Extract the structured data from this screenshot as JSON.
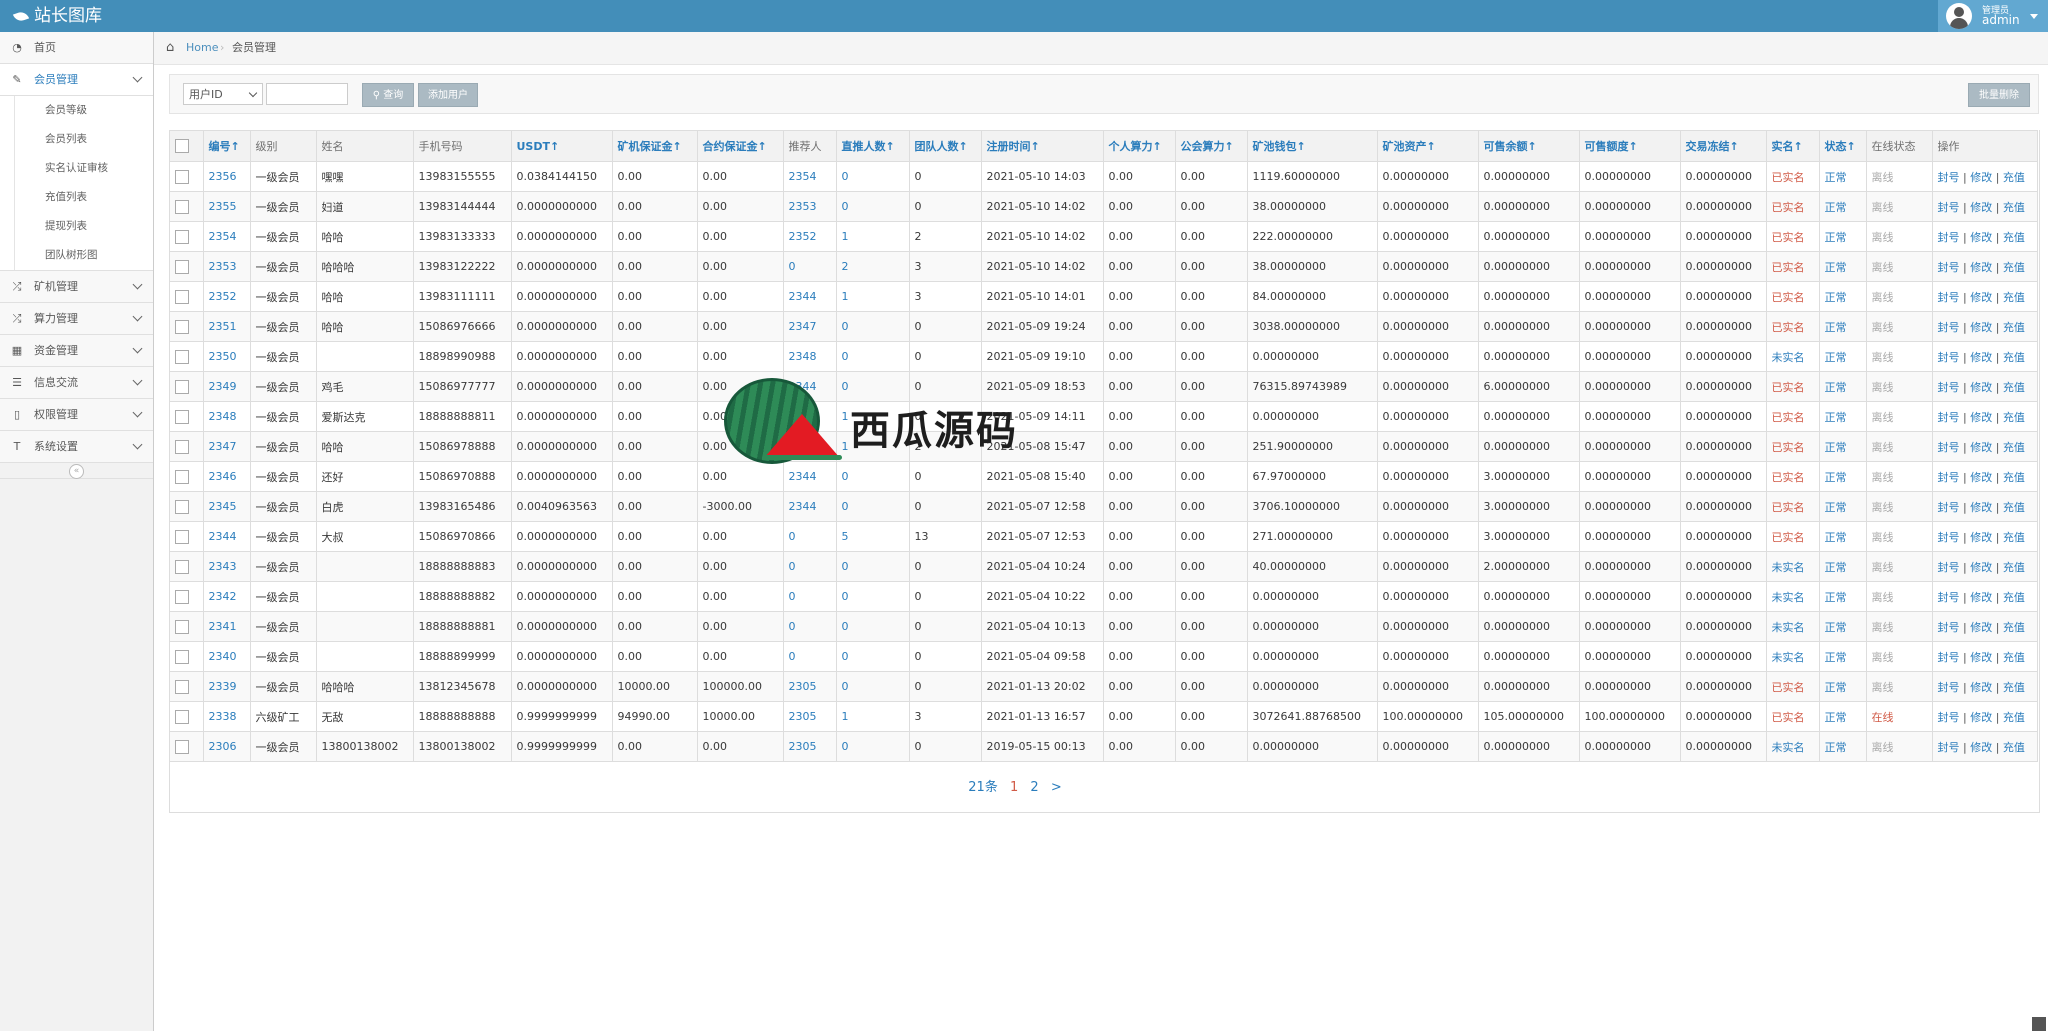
{
  "app": {
    "title": "站长图库"
  },
  "user": {
    "role": "管理员",
    "name": "admin"
  },
  "breadcrumb": {
    "home": "Home",
    "current": "会员管理"
  },
  "sidebar": {
    "items": [
      {
        "label": "首页",
        "icon": "tachometer-icon"
      },
      {
        "label": "会员管理",
        "icon": "edit-icon",
        "active": true,
        "children": [
          "会员等级",
          "会员列表",
          "实名认证审核",
          "充值列表",
          "提现列表",
          "团队树形图"
        ]
      },
      {
        "label": "矿机管理",
        "icon": "shuffle-icon"
      },
      {
        "label": "算力管理",
        "icon": "shuffle-icon"
      },
      {
        "label": "资金管理",
        "icon": "calendar-icon"
      },
      {
        "label": "信息交流",
        "icon": "list-alt-icon"
      },
      {
        "label": "权限管理",
        "icon": "file-icon"
      },
      {
        "label": "系统设置",
        "icon": "text-width-icon"
      }
    ],
    "collapse": "«"
  },
  "search": {
    "select_value": "用户ID",
    "input_value": "",
    "search_label": "查询",
    "add_label": "添加用户",
    "batch_delete_label": "批量删除"
  },
  "table": {
    "headers": [
      "编号↑",
      "级别",
      "姓名",
      "手机号码",
      "USDT↑",
      "矿机保证金↑",
      "合约保证金↑",
      "推荐人",
      "直推人数↑",
      "团队人数↑",
      "注册时间↑",
      "个人算力↑",
      "公会算力↑",
      "矿池钱包↑",
      "矿池资产↑",
      "可售余额↑",
      "可售额度↑",
      "交易冻结↑",
      "实名↑",
      "状态↑",
      "在线状态",
      "操作"
    ],
    "ops": [
      "封号",
      "修改",
      "充值"
    ],
    "rows": [
      [
        "2356",
        "一级会员",
        "嘿嘿",
        "13983155555",
        "0.0384144150",
        "0.00",
        "0.00",
        "2354",
        "0",
        "0",
        "2021-05-10 14:03",
        "0.00",
        "0.00",
        "1119.60000000",
        "0.00000000",
        "0.00000000",
        "0.00000000",
        "0.00000000",
        "已实名",
        "正常",
        "离线"
      ],
      [
        "2355",
        "一级会员",
        "妇道",
        "13983144444",
        "0.0000000000",
        "0.00",
        "0.00",
        "2353",
        "0",
        "0",
        "2021-05-10 14:02",
        "0.00",
        "0.00",
        "38.00000000",
        "0.00000000",
        "0.00000000",
        "0.00000000",
        "0.00000000",
        "已实名",
        "正常",
        "离线"
      ],
      [
        "2354",
        "一级会员",
        "哈哈",
        "13983133333",
        "0.0000000000",
        "0.00",
        "0.00",
        "2352",
        "1",
        "2",
        "2021-05-10 14:02",
        "0.00",
        "0.00",
        "222.00000000",
        "0.00000000",
        "0.00000000",
        "0.00000000",
        "0.00000000",
        "已实名",
        "正常",
        "离线"
      ],
      [
        "2353",
        "一级会员",
        "哈哈哈",
        "13983122222",
        "0.0000000000",
        "0.00",
        "0.00",
        "0",
        "2",
        "3",
        "2021-05-10 14:02",
        "0.00",
        "0.00",
        "38.00000000",
        "0.00000000",
        "0.00000000",
        "0.00000000",
        "0.00000000",
        "已实名",
        "正常",
        "离线"
      ],
      [
        "2352",
        "一级会员",
        "哈哈",
        "13983111111",
        "0.0000000000",
        "0.00",
        "0.00",
        "2344",
        "1",
        "3",
        "2021-05-10 14:01",
        "0.00",
        "0.00",
        "84.00000000",
        "0.00000000",
        "0.00000000",
        "0.00000000",
        "0.00000000",
        "已实名",
        "正常",
        "离线"
      ],
      [
        "2351",
        "一级会员",
        "哈哈",
        "15086976666",
        "0.0000000000",
        "0.00",
        "0.00",
        "2347",
        "0",
        "0",
        "2021-05-09 19:24",
        "0.00",
        "0.00",
        "3038.00000000",
        "0.00000000",
        "0.00000000",
        "0.00000000",
        "0.00000000",
        "已实名",
        "正常",
        "离线"
      ],
      [
        "2350",
        "一级会员",
        "",
        "18898990988",
        "0.0000000000",
        "0.00",
        "0.00",
        "2348",
        "0",
        "0",
        "2021-05-09 19:10",
        "0.00",
        "0.00",
        "0.00000000",
        "0.00000000",
        "0.00000000",
        "0.00000000",
        "0.00000000",
        "未实名",
        "正常",
        "离线"
      ],
      [
        "2349",
        "一级会员",
        "鸡毛",
        "15086977777",
        "0.0000000000",
        "0.00",
        "0.00",
        "2344",
        "0",
        "0",
        "2021-05-09 18:53",
        "0.00",
        "0.00",
        "76315.89743989",
        "0.00000000",
        "6.00000000",
        "0.00000000",
        "0.00000000",
        "已实名",
        "正常",
        "离线"
      ],
      [
        "2348",
        "一级会员",
        "爱斯达克",
        "18888888811",
        "0.0000000000",
        "0.00",
        "0.00",
        "2347",
        "1",
        "0",
        "2021-05-09 14:11",
        "0.00",
        "0.00",
        "0.00000000",
        "0.00000000",
        "0.00000000",
        "0.00000000",
        "0.00000000",
        "已实名",
        "正常",
        "离线"
      ],
      [
        "2347",
        "一级会员",
        "哈哈",
        "15086978888",
        "0.0000000000",
        "0.00",
        "0.00",
        "2344",
        "1",
        "2",
        "2021-05-08 15:47",
        "0.00",
        "0.00",
        "251.90000000",
        "0.00000000",
        "0.00000000",
        "0.00000000",
        "0.00000000",
        "已实名",
        "正常",
        "离线"
      ],
      [
        "2346",
        "一级会员",
        "还好",
        "15086970888",
        "0.0000000000",
        "0.00",
        "0.00",
        "2344",
        "0",
        "0",
        "2021-05-08 15:40",
        "0.00",
        "0.00",
        "67.97000000",
        "0.00000000",
        "3.00000000",
        "0.00000000",
        "0.00000000",
        "已实名",
        "正常",
        "离线"
      ],
      [
        "2345",
        "一级会员",
        "白虎",
        "13983165486",
        "0.0040963563",
        "0.00",
        "-3000.00",
        "2344",
        "0",
        "0",
        "2021-05-07 12:58",
        "0.00",
        "0.00",
        "3706.10000000",
        "0.00000000",
        "3.00000000",
        "0.00000000",
        "0.00000000",
        "已实名",
        "正常",
        "离线"
      ],
      [
        "2344",
        "一级会员",
        "大叔",
        "15086970866",
        "0.0000000000",
        "0.00",
        "0.00",
        "0",
        "5",
        "13",
        "2021-05-07 12:53",
        "0.00",
        "0.00",
        "271.00000000",
        "0.00000000",
        "3.00000000",
        "0.00000000",
        "0.00000000",
        "已实名",
        "正常",
        "离线"
      ],
      [
        "2343",
        "一级会员",
        "",
        "18888888883",
        "0.0000000000",
        "0.00",
        "0.00",
        "0",
        "0",
        "0",
        "2021-05-04 10:24",
        "0.00",
        "0.00",
        "40.00000000",
        "0.00000000",
        "2.00000000",
        "0.00000000",
        "0.00000000",
        "未实名",
        "正常",
        "离线"
      ],
      [
        "2342",
        "一级会员",
        "",
        "18888888882",
        "0.0000000000",
        "0.00",
        "0.00",
        "0",
        "0",
        "0",
        "2021-05-04 10:22",
        "0.00",
        "0.00",
        "0.00000000",
        "0.00000000",
        "0.00000000",
        "0.00000000",
        "0.00000000",
        "未实名",
        "正常",
        "离线"
      ],
      [
        "2341",
        "一级会员",
        "",
        "18888888881",
        "0.0000000000",
        "0.00",
        "0.00",
        "0",
        "0",
        "0",
        "2021-05-04 10:13",
        "0.00",
        "0.00",
        "0.00000000",
        "0.00000000",
        "0.00000000",
        "0.00000000",
        "0.00000000",
        "未实名",
        "正常",
        "离线"
      ],
      [
        "2340",
        "一级会员",
        "",
        "18888899999",
        "0.0000000000",
        "0.00",
        "0.00",
        "0",
        "0",
        "0",
        "2021-05-04 09:58",
        "0.00",
        "0.00",
        "0.00000000",
        "0.00000000",
        "0.00000000",
        "0.00000000",
        "0.00000000",
        "未实名",
        "正常",
        "离线"
      ],
      [
        "2339",
        "一级会员",
        "哈哈哈",
        "13812345678",
        "0.0000000000",
        "10000.00",
        "100000.00",
        "2305",
        "0",
        "0",
        "2021-01-13 20:02",
        "0.00",
        "0.00",
        "0.00000000",
        "0.00000000",
        "0.00000000",
        "0.00000000",
        "0.00000000",
        "已实名",
        "正常",
        "离线"
      ],
      [
        "2338",
        "六级矿工",
        "无敌",
        "18888888888",
        "0.9999999999",
        "94990.00",
        "10000.00",
        "2305",
        "1",
        "3",
        "2021-01-13 16:57",
        "0.00",
        "0.00",
        "3072641.88768500",
        "100.00000000",
        "105.00000000",
        "100.00000000",
        "0.00000000",
        "已实名",
        "正常",
        "在线"
      ],
      [
        "2306",
        "一级会员",
        "13800138002",
        "13800138002",
        "0.9999999999",
        "0.00",
        "0.00",
        "2305",
        "0",
        "0",
        "2019-05-15 00:13",
        "0.00",
        "0.00",
        "0.00000000",
        "0.00000000",
        "0.00000000",
        "0.00000000",
        "0.00000000",
        "未实名",
        "正常",
        "离线"
      ]
    ]
  },
  "pagination": {
    "total": "21条",
    "current": "1",
    "next_page": "2",
    "next": ">"
  },
  "watermark": {
    "text": "西瓜源码"
  },
  "colors": {
    "navbar": "#438eb9",
    "link": "#2b7dbc",
    "danger": "#d15b47"
  }
}
